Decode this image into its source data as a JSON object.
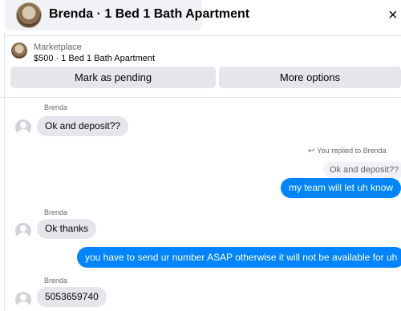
{
  "header": {
    "title": "Brenda · 1 Bed 1 Bath Apartment",
    "close_icon": "close-icon"
  },
  "marketplace": {
    "label": "Marketplace",
    "listing": "$500 · 1 Bed 1 Bath Apartment",
    "mark_pending_label": "Mark as pending",
    "more_options_label": "More options"
  },
  "messages": [
    {
      "sender": "Brenda",
      "text": "Ok and deposit??",
      "direction": "incoming"
    },
    {
      "replied_label": "You replied to Brenda",
      "quoted": "Ok and deposit??",
      "text": "my team will let uh know",
      "direction": "outgoing"
    },
    {
      "sender": "Brenda",
      "text": "Ok thanks",
      "direction": "incoming"
    },
    {
      "text": "you  have to send ur number ASAP otherwise it will not be available for uh",
      "direction": "outgoing"
    },
    {
      "sender": "Brenda",
      "text": "5053659740",
      "direction": "incoming"
    }
  ],
  "colors": {
    "outgoing_bubble": "#0084ff",
    "incoming_bubble": "#e4e6eb",
    "button_bg": "#e4e6eb"
  }
}
